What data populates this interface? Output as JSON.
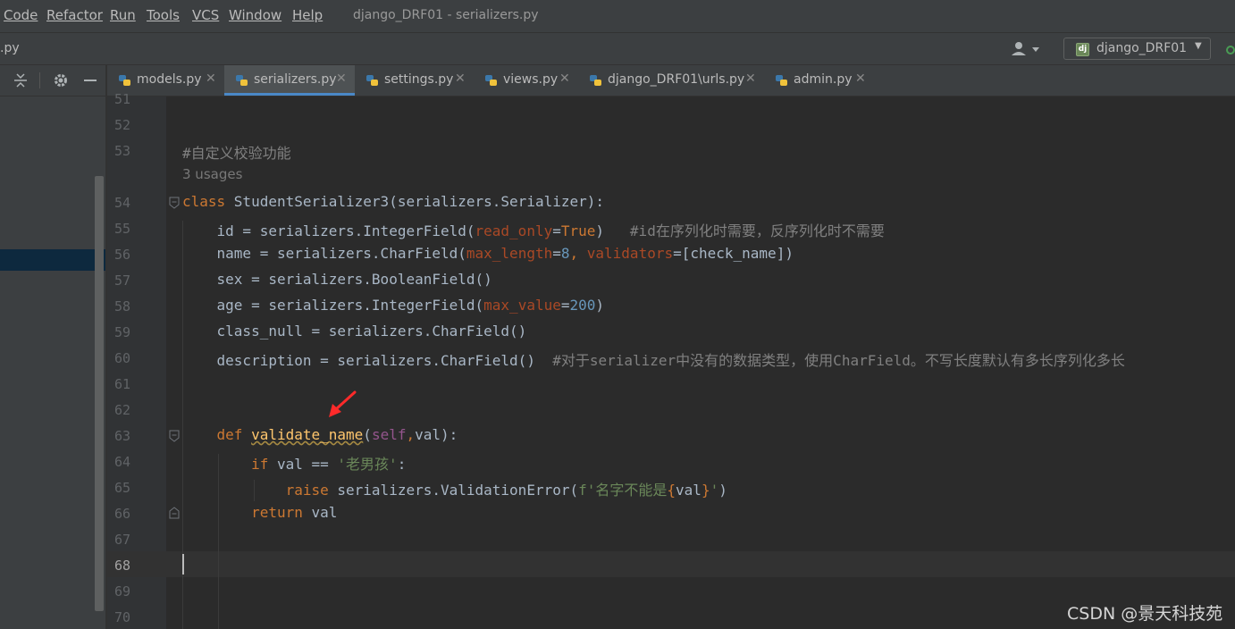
{
  "menubar": {
    "items": [
      "Code",
      "Refactor",
      "Run",
      "Tools",
      "VCS",
      "Window",
      "Help"
    ],
    "window_title": "django_DRF01 - serializers.py"
  },
  "navbar": {
    "file": ".py",
    "run_config": "django_DRF01"
  },
  "tabs": [
    {
      "label": "models.py",
      "active": false
    },
    {
      "label": "serializers.py",
      "active": true
    },
    {
      "label": "settings.py",
      "active": false
    },
    {
      "label": "views.py",
      "active": false
    },
    {
      "label": "django_DRF01\\urls.py",
      "active": false
    },
    {
      "label": "admin.py",
      "active": false
    }
  ],
  "editor": {
    "usages": "3 usages",
    "current_line": "68",
    "lines": [
      {
        "num": "51",
        "tokens": []
      },
      {
        "num": "52",
        "tokens": []
      },
      {
        "num": "53",
        "tokens": [
          {
            "t": "#自定义校验功能",
            "c": "cm"
          }
        ]
      },
      {
        "num": "54",
        "tokens": [
          {
            "t": "class ",
            "c": "kw"
          },
          {
            "t": "StudentSerializer3(serializers.Serializer):",
            "c": ""
          }
        ]
      },
      {
        "num": "55",
        "tokens": [
          {
            "t": "    id = serializers.IntegerField(",
            "c": ""
          },
          {
            "t": "read_only",
            "c": "param"
          },
          {
            "t": "=",
            "c": ""
          },
          {
            "t": "True",
            "c": "kw"
          },
          {
            "t": ")   ",
            "c": ""
          },
          {
            "t": "#id在序列化时需要，反序列化时不需要",
            "c": "cm"
          }
        ]
      },
      {
        "num": "56",
        "tokens": [
          {
            "t": "    name = serializers.CharField(",
            "c": ""
          },
          {
            "t": "max_length",
            "c": "param"
          },
          {
            "t": "=",
            "c": ""
          },
          {
            "t": "8",
            "c": "num"
          },
          {
            "t": ", ",
            "c": "kw"
          },
          {
            "t": "validators",
            "c": "param"
          },
          {
            "t": "=[check_name])",
            "c": ""
          }
        ]
      },
      {
        "num": "57",
        "tokens": [
          {
            "t": "    sex = serializers.BooleanField()",
            "c": ""
          }
        ]
      },
      {
        "num": "58",
        "tokens": [
          {
            "t": "    age = serializers.IntegerField(",
            "c": ""
          },
          {
            "t": "max_value",
            "c": "param"
          },
          {
            "t": "=",
            "c": ""
          },
          {
            "t": "200",
            "c": "num"
          },
          {
            "t": ")",
            "c": ""
          }
        ]
      },
      {
        "num": "59",
        "tokens": [
          {
            "t": "    class_null = serializers.CharField()",
            "c": ""
          }
        ]
      },
      {
        "num": "60",
        "tokens": [
          {
            "t": "    description = serializers.CharField()  ",
            "c": ""
          },
          {
            "t": "#对于serializer中没有的数据类型，使用CharField。不写长度默认有多长序列化多长",
            "c": "cm"
          }
        ]
      },
      {
        "num": "61",
        "tokens": []
      },
      {
        "num": "62",
        "tokens": []
      },
      {
        "num": "63",
        "tokens": [
          {
            "t": "    def ",
            "c": "kw"
          },
          {
            "t": "validate_name",
            "c": "fn"
          },
          {
            "t": "(",
            "c": ""
          },
          {
            "t": "self",
            "c": "slf"
          },
          {
            "t": ",",
            "c": "kw"
          },
          {
            "t": "val):",
            "c": ""
          }
        ]
      },
      {
        "num": "64",
        "tokens": [
          {
            "t": "        if ",
            "c": "kw"
          },
          {
            "t": "val == ",
            "c": ""
          },
          {
            "t": "'老男孩'",
            "c": "str"
          },
          {
            "t": ":",
            "c": ""
          }
        ]
      },
      {
        "num": "65",
        "tokens": [
          {
            "t": "            raise ",
            "c": "kw"
          },
          {
            "t": "serializers.ValidationError(",
            "c": ""
          },
          {
            "t": "f'名字不能是",
            "c": "str"
          },
          {
            "t": "{",
            "c": "brace"
          },
          {
            "t": "val",
            "c": ""
          },
          {
            "t": "}",
            "c": "brace"
          },
          {
            "t": "'",
            "c": "str"
          },
          {
            "t": ")",
            "c": ""
          }
        ]
      },
      {
        "num": "66",
        "tokens": [
          {
            "t": "        return ",
            "c": "kw"
          },
          {
            "t": "val",
            "c": ""
          }
        ]
      },
      {
        "num": "67",
        "tokens": []
      },
      {
        "num": "68",
        "tokens": []
      },
      {
        "num": "69",
        "tokens": []
      },
      {
        "num": "70",
        "tokens": []
      }
    ]
  },
  "watermark": "CSDN @景天科技苑",
  "colors": {
    "background": "#2b2b2b",
    "chrome": "#3c3f41",
    "keyword": "#cc7832",
    "comment": "#808080",
    "string": "#6a8759",
    "number": "#6897bb",
    "param": "#aa4926",
    "function": "#ffc66d",
    "annotation_arrow": "#ff2a2a",
    "tab_underline": "#4a88c7"
  }
}
